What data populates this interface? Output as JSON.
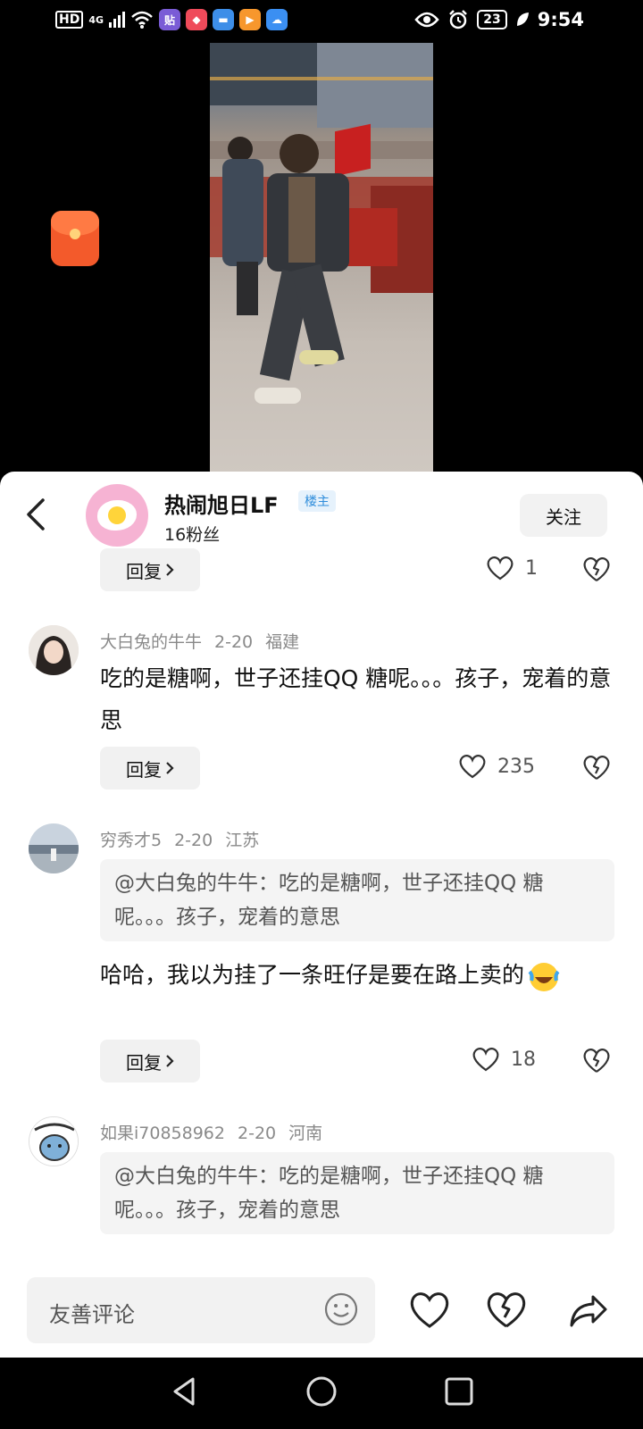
{
  "status_bar": {
    "network": "HD",
    "signal": "4G",
    "app_icons": [
      {
        "label": "贴",
        "color": "#7a5cd6"
      },
      {
        "label": "◆",
        "color": "#ef4a5a"
      },
      {
        "label": "▬",
        "color": "#3d8ee8"
      },
      {
        "label": "▶",
        "color": "#f7972d"
      },
      {
        "label": "☁",
        "color": "#3b8ff2"
      }
    ],
    "battery": "23",
    "time": "9:54"
  },
  "author": {
    "name": "热闹旭日LF",
    "badge": "楼主",
    "fans": "16粉丝",
    "follow_label": "关注"
  },
  "reply_label": "回复",
  "first_post": {
    "likes": "1"
  },
  "comments": [
    {
      "user": "大白兔的牛牛",
      "date": "2-20",
      "location": "福建",
      "text": "吃的是糖啊，世子还挂QQ 糖呢。。。孩子，宠着的意思",
      "likes": "235"
    },
    {
      "user": "穷秀才5",
      "date": "2-20",
      "location": "江苏",
      "quote": "@大白兔的牛牛：吃的是糖啊，世子还挂QQ 糖呢。。。孩子，宠着的意思",
      "text": "哈哈，我以为挂了一条旺仔是要在路上卖的",
      "likes": "18"
    },
    {
      "user": "如果i70858962",
      "date": "2-20",
      "location": "河南",
      "quote": "@大白兔的牛牛：吃的是糖啊，世子还挂QQ 糖呢。。。孩子，宠着的意思"
    }
  ],
  "input": {
    "placeholder": "友善评论"
  },
  "icons": {
    "back": "back-arrow-icon",
    "like": "heart-icon",
    "dislike": "broken-heart-icon",
    "emoji": "smile-icon",
    "share": "share-icon",
    "red_packet": "red-packet-icon"
  }
}
